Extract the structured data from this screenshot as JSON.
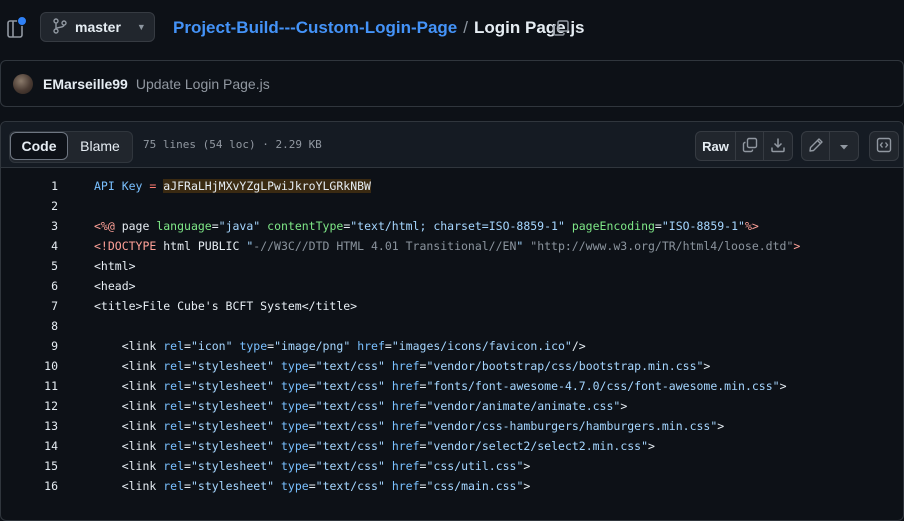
{
  "header": {
    "branch": "master",
    "repo": "Project-Build---Custom-Login-Page",
    "separator": "/",
    "file": "Login Page.js"
  },
  "commit": {
    "author": "EMarseille99",
    "message": "Update Login Page.js"
  },
  "file_header": {
    "tabs": [
      "Code",
      "Blame"
    ],
    "info": "75 lines (54 loc) · 2.29 KB",
    "raw_label": "Raw"
  },
  "code": {
    "lines": [
      {
        "n": "1",
        "segs": [
          [
            "t-key",
            "API Key "
          ],
          [
            "t-op",
            "="
          ],
          [
            "t-plain",
            " "
          ],
          [
            "t-hl",
            "aJFRaLHjMXvYZgLPwiJkroYLGRkNBW"
          ]
        ]
      },
      {
        "n": "2",
        "segs": []
      },
      {
        "n": "3",
        "segs": [
          [
            "t-red",
            "<%@ "
          ],
          [
            "t-plain",
            "page "
          ],
          [
            "t-attr",
            "language"
          ],
          [
            "t-plain",
            "="
          ],
          [
            "t-str",
            "\"java\""
          ],
          [
            "t-plain",
            " "
          ],
          [
            "t-attr",
            "contentType"
          ],
          [
            "t-plain",
            "="
          ],
          [
            "t-str",
            "\"text/html; charset=ISO-8859-1\""
          ],
          [
            "t-plain",
            " "
          ],
          [
            "t-attr",
            "pageEncoding"
          ],
          [
            "t-plain",
            "="
          ],
          [
            "t-str",
            "\"ISO-8859-1\""
          ],
          [
            "t-red",
            "%>"
          ]
        ]
      },
      {
        "n": "4",
        "segs": [
          [
            "t-red",
            "<!DOCTYPE "
          ],
          [
            "t-plain",
            "html PUBLIC "
          ],
          [
            "t-str",
            "\""
          ],
          [
            "t-doc",
            "-//W3C//DTD HTML 4.01 Transitional//EN"
          ],
          [
            "t-str",
            "\""
          ],
          [
            "t-plain",
            " "
          ],
          [
            "t-doc",
            "\"http://www.w3.org/TR/html4/loose.dtd\""
          ],
          [
            "t-red",
            ">"
          ]
        ]
      },
      {
        "n": "5",
        "segs": [
          [
            "t-tag",
            "<html>"
          ]
        ]
      },
      {
        "n": "6",
        "segs": [
          [
            "t-tag",
            "<head>"
          ]
        ]
      },
      {
        "n": "7",
        "segs": [
          [
            "t-tag",
            "<title>"
          ],
          [
            "t-plain",
            "File Cube's BCFT System"
          ],
          [
            "t-tag",
            "</title>"
          ]
        ]
      },
      {
        "n": "8",
        "segs": []
      },
      {
        "n": "9",
        "segs": [
          [
            "t-plain",
            "    "
          ],
          [
            "t-tag",
            "<link "
          ],
          [
            "t-attr2",
            "rel"
          ],
          [
            "t-plain",
            "="
          ],
          [
            "t-str",
            "\"icon\""
          ],
          [
            "t-plain",
            " "
          ],
          [
            "t-attr2",
            "type"
          ],
          [
            "t-plain",
            "="
          ],
          [
            "t-str",
            "\"image/png\""
          ],
          [
            "t-plain",
            " "
          ],
          [
            "t-attr2",
            "href"
          ],
          [
            "t-plain",
            "="
          ],
          [
            "t-str",
            "\"images/icons/favicon.ico\""
          ],
          [
            "t-tag",
            "/>"
          ]
        ]
      },
      {
        "n": "10",
        "segs": [
          [
            "t-plain",
            "    "
          ],
          [
            "t-tag",
            "<link "
          ],
          [
            "t-attr2",
            "rel"
          ],
          [
            "t-plain",
            "="
          ],
          [
            "t-str",
            "\"stylesheet\""
          ],
          [
            "t-plain",
            " "
          ],
          [
            "t-attr2",
            "type"
          ],
          [
            "t-plain",
            "="
          ],
          [
            "t-str",
            "\"text/css\""
          ],
          [
            "t-plain",
            " "
          ],
          [
            "t-attr2",
            "href"
          ],
          [
            "t-plain",
            "="
          ],
          [
            "t-str",
            "\"vendor/bootstrap/css/bootstrap.min.css\""
          ],
          [
            "t-tag",
            ">"
          ]
        ]
      },
      {
        "n": "11",
        "segs": [
          [
            "t-plain",
            "    "
          ],
          [
            "t-tag",
            "<link "
          ],
          [
            "t-attr2",
            "rel"
          ],
          [
            "t-plain",
            "="
          ],
          [
            "t-str",
            "\"stylesheet\""
          ],
          [
            "t-plain",
            " "
          ],
          [
            "t-attr2",
            "type"
          ],
          [
            "t-plain",
            "="
          ],
          [
            "t-str",
            "\"text/css\""
          ],
          [
            "t-plain",
            " "
          ],
          [
            "t-attr2",
            "href"
          ],
          [
            "t-plain",
            "="
          ],
          [
            "t-str",
            "\"fonts/font-awesome-4.7.0/css/font-awesome.min.css\""
          ],
          [
            "t-tag",
            ">"
          ]
        ]
      },
      {
        "n": "12",
        "segs": [
          [
            "t-plain",
            "    "
          ],
          [
            "t-tag",
            "<link "
          ],
          [
            "t-attr2",
            "rel"
          ],
          [
            "t-plain",
            "="
          ],
          [
            "t-str",
            "\"stylesheet\""
          ],
          [
            "t-plain",
            " "
          ],
          [
            "t-attr2",
            "type"
          ],
          [
            "t-plain",
            "="
          ],
          [
            "t-str",
            "\"text/css\""
          ],
          [
            "t-plain",
            " "
          ],
          [
            "t-attr2",
            "href"
          ],
          [
            "t-plain",
            "="
          ],
          [
            "t-str",
            "\"vendor/animate/animate.css\""
          ],
          [
            "t-tag",
            ">"
          ]
        ]
      },
      {
        "n": "13",
        "segs": [
          [
            "t-plain",
            "    "
          ],
          [
            "t-tag",
            "<link "
          ],
          [
            "t-attr2",
            "rel"
          ],
          [
            "t-plain",
            "="
          ],
          [
            "t-str",
            "\"stylesheet\""
          ],
          [
            "t-plain",
            " "
          ],
          [
            "t-attr2",
            "type"
          ],
          [
            "t-plain",
            "="
          ],
          [
            "t-str",
            "\"text/css\""
          ],
          [
            "t-plain",
            " "
          ],
          [
            "t-attr2",
            "href"
          ],
          [
            "t-plain",
            "="
          ],
          [
            "t-str",
            "\"vendor/css-hamburgers/hamburgers.min.css\""
          ],
          [
            "t-tag",
            ">"
          ]
        ]
      },
      {
        "n": "14",
        "segs": [
          [
            "t-plain",
            "    "
          ],
          [
            "t-tag",
            "<link "
          ],
          [
            "t-attr2",
            "rel"
          ],
          [
            "t-plain",
            "="
          ],
          [
            "t-str",
            "\"stylesheet\""
          ],
          [
            "t-plain",
            " "
          ],
          [
            "t-attr2",
            "type"
          ],
          [
            "t-plain",
            "="
          ],
          [
            "t-str",
            "\"text/css\""
          ],
          [
            "t-plain",
            " "
          ],
          [
            "t-attr2",
            "href"
          ],
          [
            "t-plain",
            "="
          ],
          [
            "t-str",
            "\"vendor/select2/select2.min.css\""
          ],
          [
            "t-tag",
            ">"
          ]
        ]
      },
      {
        "n": "15",
        "segs": [
          [
            "t-plain",
            "    "
          ],
          [
            "t-tag",
            "<link "
          ],
          [
            "t-attr2",
            "rel"
          ],
          [
            "t-plain",
            "="
          ],
          [
            "t-str",
            "\"stylesheet\""
          ],
          [
            "t-plain",
            " "
          ],
          [
            "t-attr2",
            "type"
          ],
          [
            "t-plain",
            "="
          ],
          [
            "t-str",
            "\"text/css\""
          ],
          [
            "t-plain",
            " "
          ],
          [
            "t-attr2",
            "href"
          ],
          [
            "t-plain",
            "="
          ],
          [
            "t-str",
            "\"css/util.css\""
          ],
          [
            "t-tag",
            ">"
          ]
        ]
      },
      {
        "n": "16",
        "segs": [
          [
            "t-plain",
            "    "
          ],
          [
            "t-tag",
            "<link "
          ],
          [
            "t-attr2",
            "rel"
          ],
          [
            "t-plain",
            "="
          ],
          [
            "t-str",
            "\"stylesheet\""
          ],
          [
            "t-plain",
            " "
          ],
          [
            "t-attr2",
            "type"
          ],
          [
            "t-plain",
            "="
          ],
          [
            "t-str",
            "\"text/css\""
          ],
          [
            "t-plain",
            " "
          ],
          [
            "t-attr2",
            "href"
          ],
          [
            "t-plain",
            "="
          ],
          [
            "t-str",
            "\"css/main.css\""
          ],
          [
            "t-tag",
            ">"
          ]
        ]
      }
    ]
  },
  "icons": {
    "sidebar_toggle": "sidebar-toggle-icon",
    "branch": "git-branch-icon",
    "copy_path": "copy-icon",
    "copy_raw": "copy-icon",
    "download": "download-icon",
    "edit": "pencil-icon",
    "more": "triangle-down-icon",
    "symbols": "code-square-icon"
  },
  "colors": {
    "accent": "#4493f8",
    "background": "#0d1117",
    "notification": "#2f81f7"
  }
}
